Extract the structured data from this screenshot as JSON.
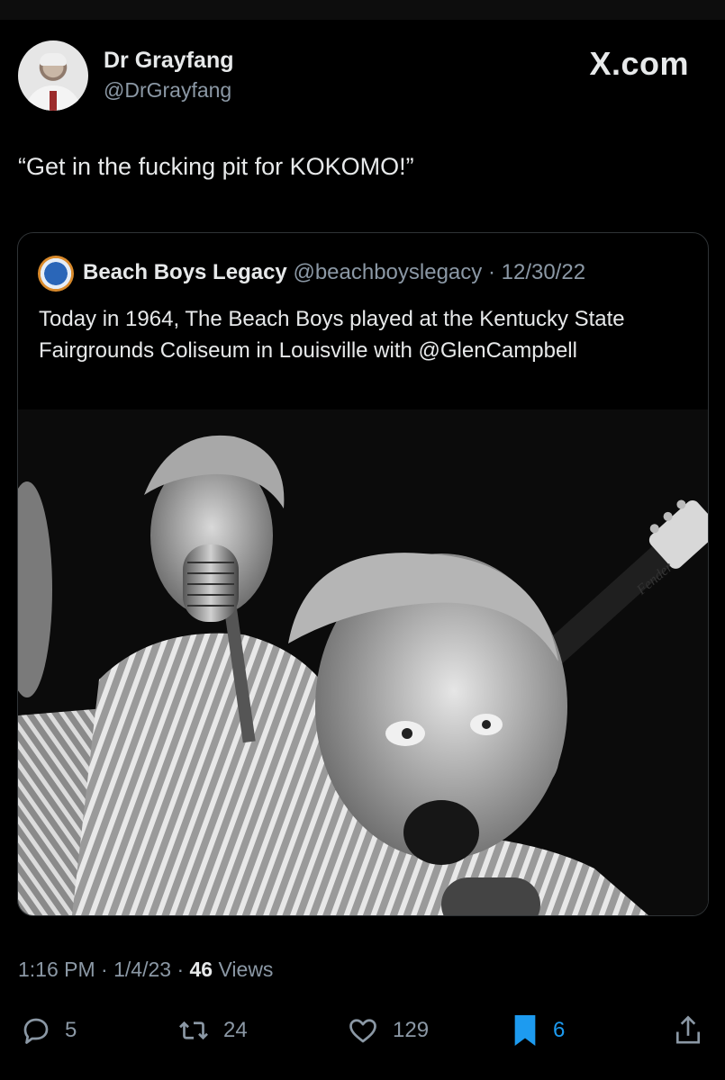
{
  "author": {
    "name": "Dr Grayfang",
    "handle": "@DrGrayfang"
  },
  "branding": {
    "site": "X.com"
  },
  "tweet": {
    "text": "“Get in the fucking pit for KOKOMO!”"
  },
  "quoted_tweet": {
    "name": "Beach Boys Legacy",
    "handle": "@beachboyslegacy",
    "separator": "·",
    "date": "12/30/22",
    "text": "Today in 1964, The Beach Boys played at the Kentucky State Fairgrounds Coliseum in Louisville with @GlenCampbell",
    "photo_headstock_text": "Fender"
  },
  "meta": {
    "time": "1:16 PM",
    "sep1": "·",
    "date": "1/4/23",
    "sep2": "·",
    "views_count": "46",
    "views_label": "Views"
  },
  "actions": {
    "replies": "5",
    "reposts": "24",
    "likes": "129",
    "bookmarks": "6"
  },
  "icons": {
    "reply": "reply-icon",
    "repost": "repost-icon",
    "like": "heart-icon",
    "bookmark": "bookmark-icon",
    "share": "share-icon"
  },
  "colors": {
    "background": "#000000",
    "text": "#e7e9ea",
    "muted": "#8b98a5",
    "accent": "#1d9bf0"
  }
}
